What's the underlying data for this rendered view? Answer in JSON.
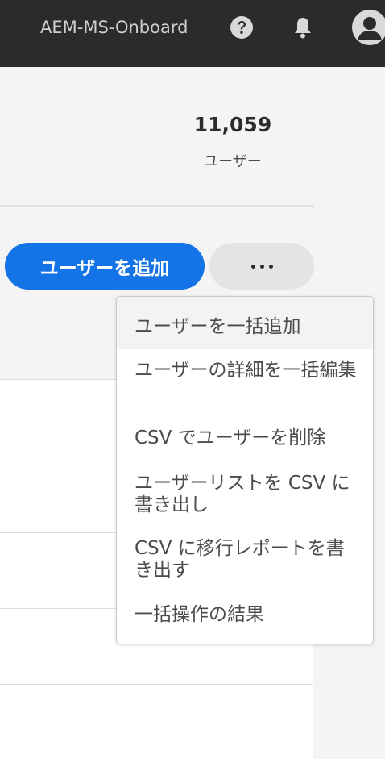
{
  "header": {
    "org_name": "AEM-MS-Onboard",
    "icons": [
      "help-icon",
      "bell-icon",
      "avatar-icon"
    ]
  },
  "summary": {
    "count": "11,059",
    "label": "ユーザー"
  },
  "actions": {
    "add_user_label": "ユーザーを追加",
    "more_label": "..."
  },
  "menu": {
    "items": [
      "ユーザーを一括追加",
      "ユーザーの詳細を一括編集",
      "CSV でユーザーを削除",
      "ユーザーリストを CSV に書き出し",
      "CSV に移行レポートを書き出す",
      "一括操作の結果"
    ]
  },
  "colors": {
    "header_bg": "#2b2b2b",
    "primary": "#1473e6",
    "page_bg": "#f4f4f4"
  }
}
